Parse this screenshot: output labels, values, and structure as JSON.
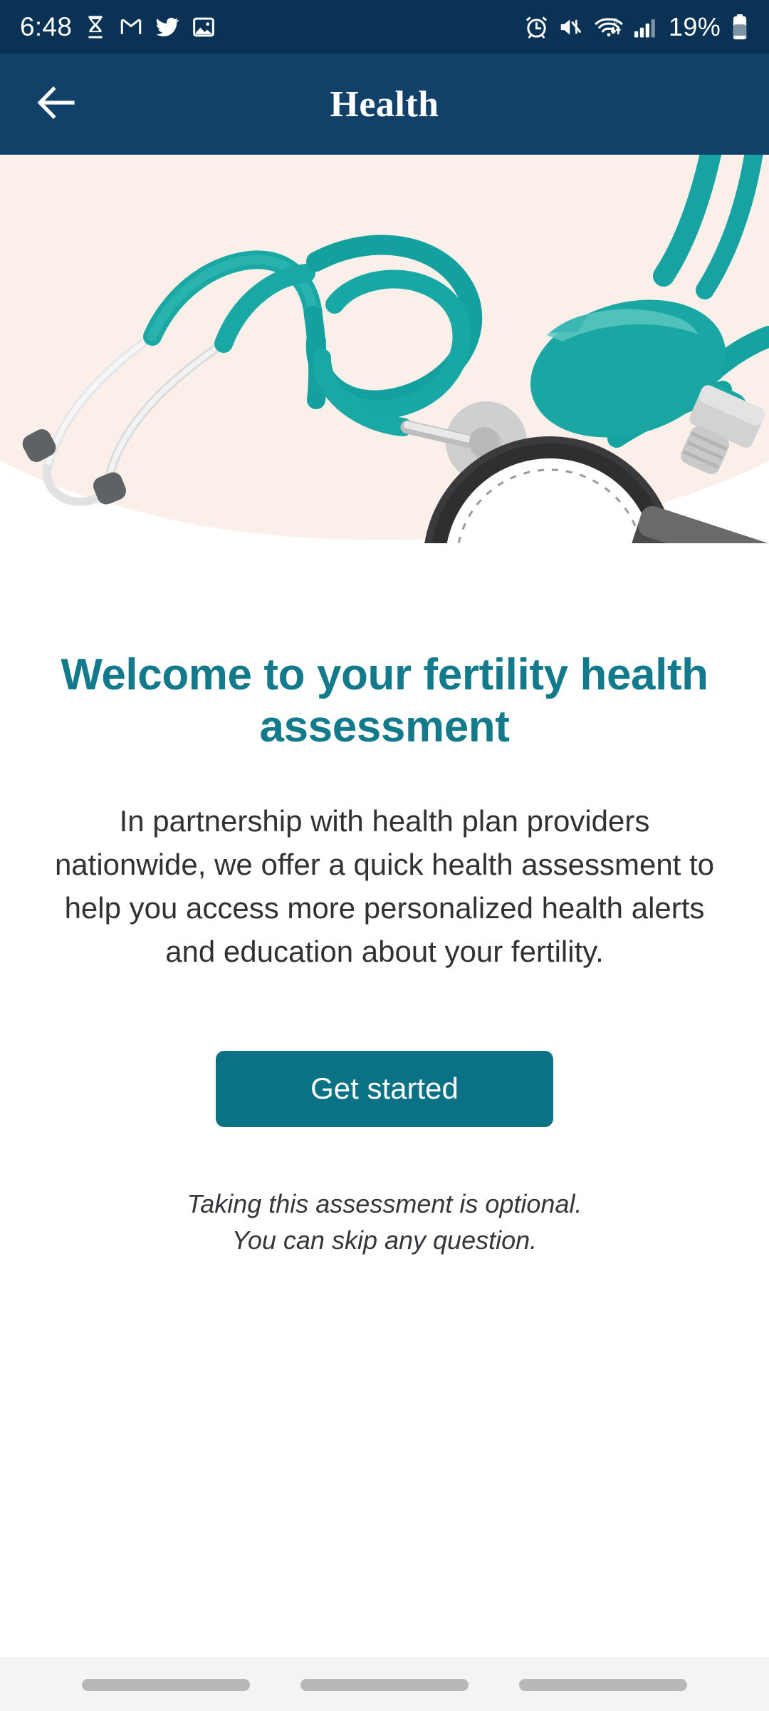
{
  "status_bar": {
    "time": "6:48",
    "battery_percent": "19%",
    "left_icons": [
      "hourglass-icon",
      "gmail-icon",
      "twitter-icon",
      "photo-icon"
    ],
    "right_icons": [
      "alarm-icon",
      "mute-vibrate-icon",
      "wifi-icon",
      "signal-icon",
      "battery-icon"
    ],
    "background_color": "#0a3254"
  },
  "app_bar": {
    "title": "Health",
    "back_icon": "arrow-left-icon",
    "background_color": "#114069"
  },
  "hero": {
    "alt": "stethoscope and blood pressure monitor illustration",
    "background_color": "#fbefe9",
    "teal_color": "#17a3a3",
    "teal_dark_color": "#0f9294",
    "gray_color": "#d8d8d8",
    "dark_color": "#3b3b3d"
  },
  "main": {
    "headline": "Welcome to your fertility health assessment",
    "body": "In partnership with health plan providers nationwide, we offer a quick health assessment to help you access more personalized health alerts and education about your fertility.",
    "cta_label": "Get started",
    "footnote_line_1": "Taking this assessment is optional.",
    "footnote_line_2": "You can skip any question.",
    "accent_color": "#127a8a",
    "button_color": "#0b7285"
  },
  "nav_bar": {
    "items": [
      "nav-pill-left",
      "nav-pill-center",
      "nav-pill-right"
    ],
    "background_color": "#f4f4f5"
  }
}
